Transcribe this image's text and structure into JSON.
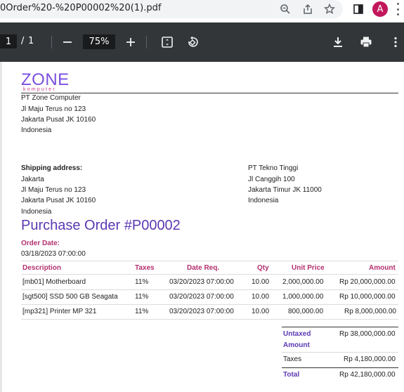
{
  "browser": {
    "url_text": "0Order%20-%20P00002%20(1).pdf",
    "avatar_letter": "A"
  },
  "pdf_toolbar": {
    "page_current": "1",
    "page_sep": "/",
    "page_total": "1",
    "zoom": "75%"
  },
  "company": {
    "logo_text": "ZONE",
    "logo_subtext": "komputer",
    "address": [
      "PT Zone Computer",
      "Jl Maju Terus no 123",
      "Jakarta Pusat JK 10160",
      "Indonesia"
    ]
  },
  "shipping": {
    "label": "Shipping address:",
    "lines": [
      "Jakarta",
      "Jl Maju Terus no 123",
      "Jakarta Pusat JK 10160",
      "Indonesia"
    ]
  },
  "vendor": {
    "lines": [
      "PT Tekno Tinggi",
      "Jl Canggih 100",
      "Jakarta Timur JK 11000",
      "Indonesia"
    ]
  },
  "order": {
    "title": "Purchase Order #P00002",
    "date_label": "Order Date:",
    "date_value": "03/18/2023 07:00:00"
  },
  "table": {
    "headers": [
      "Description",
      "Taxes",
      "Date Req.",
      "Qty",
      "Unit Price",
      "Amount"
    ],
    "rows": [
      [
        "[mb01] Motherboard",
        "11%",
        "03/20/2023 07:00:00",
        "10.00",
        "2,000,000.00",
        "Rp 20,000,000.00"
      ],
      [
        "[sgt500] SSD 500 GB Seagata",
        "11%",
        "03/20/2023 07:00:00",
        "10.00",
        "1,000,000.00",
        "Rp 10,000,000.00"
      ],
      [
        "[mp321] Printer MP 321",
        "11%",
        "03/20/2023 07:00:00",
        "10.00",
        "800,000.00",
        "Rp 8,000,000.00"
      ]
    ]
  },
  "totals": {
    "untaxed_label_1": "Untaxed",
    "untaxed_label_2": "Amount",
    "untaxed_value": "Rp 38,000,000.00",
    "taxes_label": "Taxes",
    "taxes_value": "Rp 4,180,000.00",
    "total_label": "Total",
    "total_value": "Rp 42,180,000.00"
  }
}
